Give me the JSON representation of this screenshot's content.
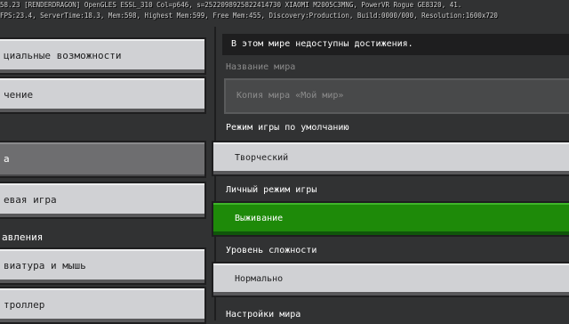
{
  "debug": {
    "line1": "58.23 [RENDERDRAGON] OpenGLES ESSL_310 Col=p646, s=2522098925822414730 XIAOMI M2005C3MNG, PowerVR Rogue GE8320, 41.",
    "line2": "FPS:23.4, ServerTime:18.3, Mem:598, Highest Mem:599, Free Mem:455, Discovery:Production, Build:0000/000, Resolution:1600x720"
  },
  "left": {
    "item_social": "циальные возможности",
    "item_2": "чение",
    "item_selected": "а",
    "item_multiplayer": "евая игра",
    "section_controls": "авления",
    "item_keyboard": "виатура и мышь",
    "item_controller": "троллер"
  },
  "right": {
    "notice": "В этом мире недоступны достижения.",
    "world_name_label": "Название мира",
    "world_name_value": "Копия мира «Мой мир»",
    "default_mode_label": "Режим игры по умолчанию",
    "default_mode_value": "Творческий",
    "personal_mode_label": "Личный режим игры",
    "personal_mode_value": "Выживание",
    "difficulty_label": "Уровень сложности",
    "difficulty_value": "Нормально",
    "world_settings_label": "Настройки мира"
  }
}
